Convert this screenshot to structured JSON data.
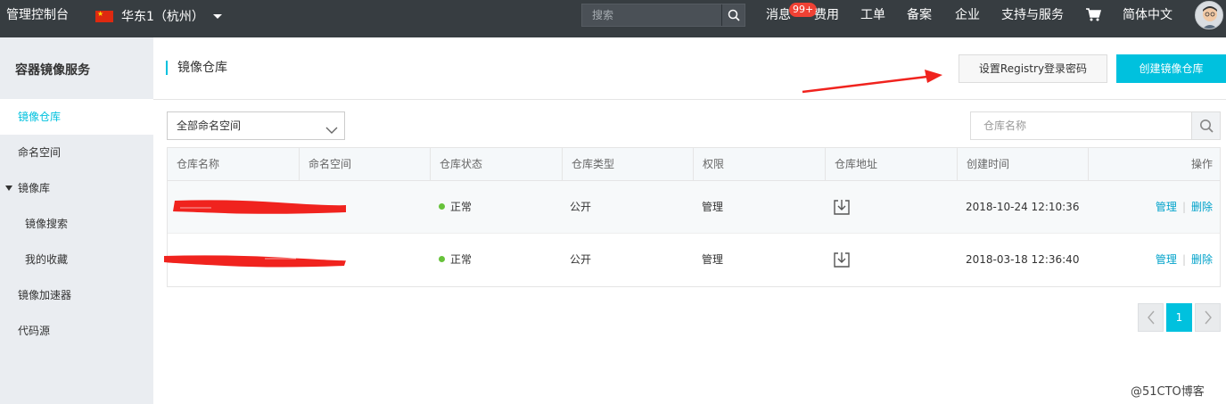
{
  "topbar": {
    "console": "管理控制台",
    "region": "华东1（杭州）",
    "search_placeholder": "搜索",
    "messages": "消息",
    "messages_badge": "99+",
    "billing": "费用",
    "tickets": "工单",
    "icp": "备案",
    "enterprise": "企业",
    "support": "支持与服务",
    "language": "简体中文",
    "icons": [
      "flag-cn-icon",
      "caret-down-icon",
      "search-icon",
      "cart-icon",
      "avatar"
    ]
  },
  "sidebar": {
    "title": "容器镜像服务",
    "items": [
      {
        "label": "镜像仓库",
        "active": true
      },
      {
        "label": "命名空间"
      },
      {
        "label": "镜像库",
        "expanded": true
      },
      {
        "label": "镜像搜索",
        "sub": true
      },
      {
        "label": "我的收藏",
        "sub": true
      },
      {
        "label": "镜像加速器"
      },
      {
        "label": "代码源"
      }
    ]
  },
  "main": {
    "title": "镜像仓库",
    "btn_registry_password": "设置Registry登录密码",
    "btn_create_repo": "创建镜像仓库",
    "namespace_select": "全部命名空间",
    "repo_search_placeholder": "仓库名称",
    "table": {
      "headers": [
        "仓库名称",
        "命名空间",
        "仓库状态",
        "仓库类型",
        "权限",
        "仓库地址",
        "创建时间",
        "操作"
      ],
      "rows": [
        {
          "name": "",
          "namespace": "",
          "status": "正常",
          "type": "公开",
          "permission": "管理",
          "created": "2018-10-24 12:10:36",
          "action_manage": "管理",
          "action_delete": "删除"
        },
        {
          "name": "",
          "namespace": "",
          "status": "正常",
          "type": "公开",
          "permission": "管理",
          "created": "2018-03-18 12:36:40",
          "action_manage": "管理",
          "action_delete": "删除"
        }
      ]
    },
    "pagination": {
      "current": "1"
    }
  },
  "colors": {
    "topbar": "#373d41",
    "accent": "#00c1de",
    "annotation": "#f0231e"
  },
  "watermark": "@51CTO博客"
}
